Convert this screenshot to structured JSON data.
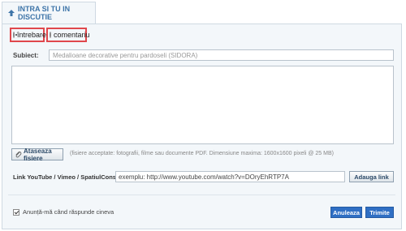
{
  "tab": {
    "title": "INTRA SI TU IN DISCUTIE",
    "icon": "arrow-up-icon"
  },
  "post_type": {
    "options": [
      {
        "label": "întrebare",
        "checked": true
      },
      {
        "label": "comentariu",
        "checked": false
      }
    ],
    "highlight_color": "#e0474c"
  },
  "subject": {
    "label": "Subiect:",
    "placeholder": "Medalioane decorative pentru pardoseli (SIDORA)"
  },
  "body": {
    "value": ""
  },
  "attachments": {
    "button_label": "Ataseaza fisiere",
    "icon": "paperclip-icon",
    "hint": "(fisiere acceptate: fotografii, filme sau documente PDF. Dimensiune maxima: 1600x1600 pixeli @ 25 MB)"
  },
  "link": {
    "label": "Link YouTube / Vimeo / SpatiulConstruit:",
    "value": "exemplu: http://www.youtube.com/watch?v=DOryEhRTP7A",
    "button_label": "Adauga link"
  },
  "notify": {
    "label": "Anunță-mă când răspunde cineva",
    "checked": true
  },
  "actions": {
    "cancel_label": "Anuleaza",
    "submit_label": "Trimite"
  },
  "colors": {
    "accent": "#2f6fc4",
    "tab_text": "#3d74a8",
    "panel_bg": "#f3f7fa"
  }
}
